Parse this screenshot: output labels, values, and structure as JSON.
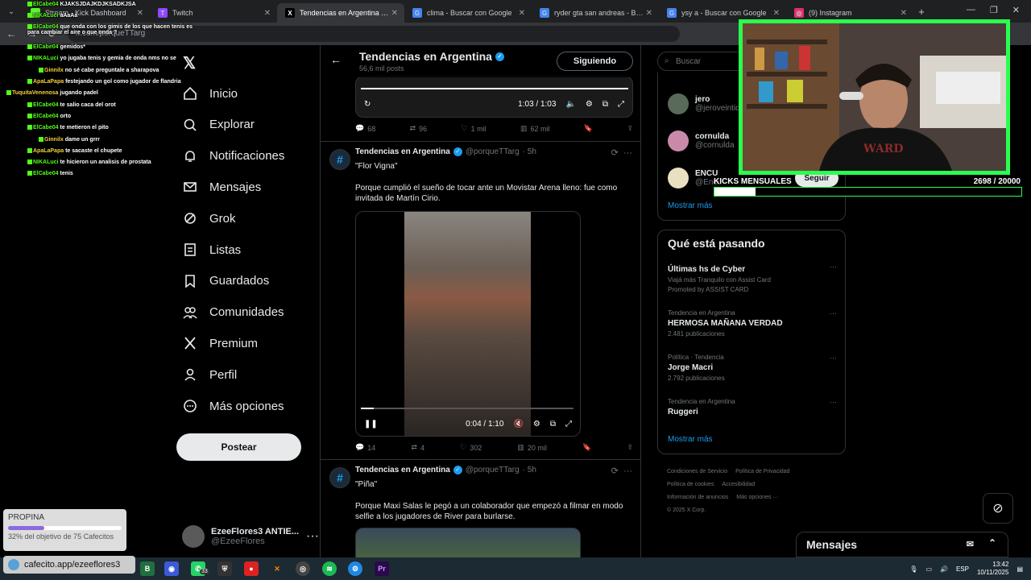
{
  "browser": {
    "tabs": [
      {
        "title": "Stream - Kick Dashboard",
        "icon": "K",
        "color": "#53fc18"
      },
      {
        "title": "Twitch",
        "icon": "T",
        "color": "#9146ff"
      },
      {
        "title": "Tendencias en Argentina (@po",
        "icon": "X",
        "color": "#000000"
      },
      {
        "title": "clima - Buscar con Google",
        "icon": "G",
        "color": "#4285f4"
      },
      {
        "title": "ryder gta san andreas - Buscar",
        "icon": "G",
        "color": "#4285f4"
      },
      {
        "title": "ysy a - Buscar con Google",
        "icon": "G",
        "color": "#4285f4"
      },
      {
        "title": "(9) Instagram",
        "icon": "◎",
        "color": "#e1306c"
      }
    ],
    "url": "x.com/porqueTTarg"
  },
  "nav": {
    "items": [
      {
        "label": "Inicio",
        "icon": "home-icon"
      },
      {
        "label": "Explorar",
        "icon": "search-icon"
      },
      {
        "label": "Notificaciones",
        "icon": "bell-icon"
      },
      {
        "label": "Mensajes",
        "icon": "mail-icon"
      },
      {
        "label": "Grok",
        "icon": "grok-icon"
      },
      {
        "label": "Listas",
        "icon": "list-icon"
      },
      {
        "label": "Guardados",
        "icon": "bookmark-icon"
      },
      {
        "label": "Comunidades",
        "icon": "people-icon"
      },
      {
        "label": "Premium",
        "icon": "x-icon"
      },
      {
        "label": "Perfil",
        "icon": "person-icon"
      },
      {
        "label": "Más opciones",
        "icon": "more-icon"
      }
    ],
    "post_button": "Postear",
    "profile": {
      "name": "EzeeFlores3 ANTIE...",
      "handle": "@EzeeFlores"
    }
  },
  "feed": {
    "title": "Tendencias en Argentina",
    "subtitle": "56,6 mil posts",
    "follow": "Siguiendo",
    "top_video": {
      "time": "1:03 / 1:03",
      "progress": 1.0
    },
    "top_actions": {
      "replies": "68",
      "reposts": "96",
      "likes": "1 mil",
      "views": "62 mil"
    },
    "tweets": [
      {
        "name": "Tendencias en Argentina",
        "handle": "@porqueTTarg",
        "time": "· 5h",
        "title": "\"Flor Vigna\"",
        "body": "Porque cumplió el sueño de tocar ante un Movistar Arena lleno: fue como invitada de Martín Cirio.",
        "video_time": "0:04 / 1:10",
        "video_progress": 0.06,
        "replies": "14",
        "reposts": "4",
        "likes": "302",
        "views": "20 mil"
      },
      {
        "name": "Tendencias en Argentina",
        "handle": "@porqueTTarg",
        "time": "· 5h",
        "title": "\"Piña\"",
        "body": "Porque Maxi Salas le pegó a un colaborador que empezó a filmar en modo selfie a los jugadores de River para burlarse."
      }
    ]
  },
  "sidebar": {
    "search_placeholder": "Buscar",
    "who_to_follow": [
      {
        "name": "jero",
        "handle": "@jeroveintidos"
      },
      {
        "name": "cornulda",
        "handle": "@cornulda"
      },
      {
        "name": "ENCU",
        "handle": "@Encu"
      }
    ],
    "follow_label": "Seguir",
    "show_more": "Mostrar más",
    "happening_title": "Qué está pasando",
    "trends": [
      {
        "context": "",
        "name": "Últimas hs de Cyber",
        "count": "Viajá más Tranquilo con Assist Card",
        "promo": "Promoted by ASSIST CARD"
      },
      {
        "context": "Tendencia en Argentina",
        "name": "HERMOSA MAÑANA VERDAD",
        "count": "2.481 publicaciones"
      },
      {
        "context": "Política · Tendencia",
        "name": "Jorge Macri",
        "count": "2.792 publicaciones"
      },
      {
        "context": "Tendencia en Argentina",
        "name": "Ruggeri",
        "count": ""
      }
    ],
    "show_more_2": "Mostrar más",
    "footer": [
      "Condiciones de Servicio",
      "Política de Privacidad",
      "Política de cookies",
      "Accesibilidad",
      "Información de anuncios",
      "Más opciones ···",
      "© 2025 X Corp."
    ],
    "messages": "Mensajes"
  },
  "chat": [
    {
      "user": "ElCabe04",
      "color": "#53fc18",
      "msg": "KJAKSJDAJKDJKSADKJSA"
    },
    {
      "user": "NIKALuci",
      "color": "#53fc18",
      "msg": "aAaAa"
    },
    {
      "user": "ElCabe04",
      "color": "#53fc18",
      "msg": "que onda con los gimis de los que hacen tenis es para cambiar el aire o que onda ?"
    },
    {
      "user": "ElCabe04",
      "color": "#53fc18",
      "msg": "gemidos*"
    },
    {
      "user": "NIKALuci",
      "color": "#53fc18",
      "msg": "yo jugaba tenis y gemia de onda nms no se"
    },
    {
      "user": "Ginnilx",
      "color": "#f4d03f",
      "msg": "no sé cabe preguntale a sharapova"
    },
    {
      "user": "ApaLaPapa",
      "color": "#f4d03f",
      "msg": "festejando un gol como jugador de flandria"
    },
    {
      "user": "TuquitaVenenosa",
      "color": "#f4d03f",
      "msg": "jugando padel"
    },
    {
      "user": "ElCabe04",
      "color": "#53fc18",
      "msg": "te salio caca del orot"
    },
    {
      "user": "ElCabe04",
      "color": "#53fc18",
      "msg": "orto"
    },
    {
      "user": "ElCabe04",
      "color": "#53fc18",
      "msg": "te metieron el pito"
    },
    {
      "user": "Ginnilx",
      "color": "#f4d03f",
      "msg": "dame un grrr"
    },
    {
      "user": "ApaLaPapa",
      "color": "#f4d03f",
      "msg": "te sacaste el chupete"
    },
    {
      "user": "NIKALuci",
      "color": "#53fc18",
      "msg": "te hicieron un analisis de prostata"
    },
    {
      "user": "ElCabe04",
      "color": "#53fc18",
      "msg": "tenis"
    }
  ],
  "kick_goal": {
    "label": "KICKS MENSUALES",
    "value": "2698",
    "target": "20000",
    "display": "2698  /  20000",
    "fraction": 0.135
  },
  "propina": {
    "title": "PROPINA",
    "sub": "32% del objetivo de 75 Cafecitos",
    "fraction": 0.32
  },
  "cafecito": "cafecito.app/ezeeflores3",
  "taskbar": {
    "lang": "ESP",
    "time": "13:42",
    "date": "10/11/2025",
    "badge": "33"
  }
}
